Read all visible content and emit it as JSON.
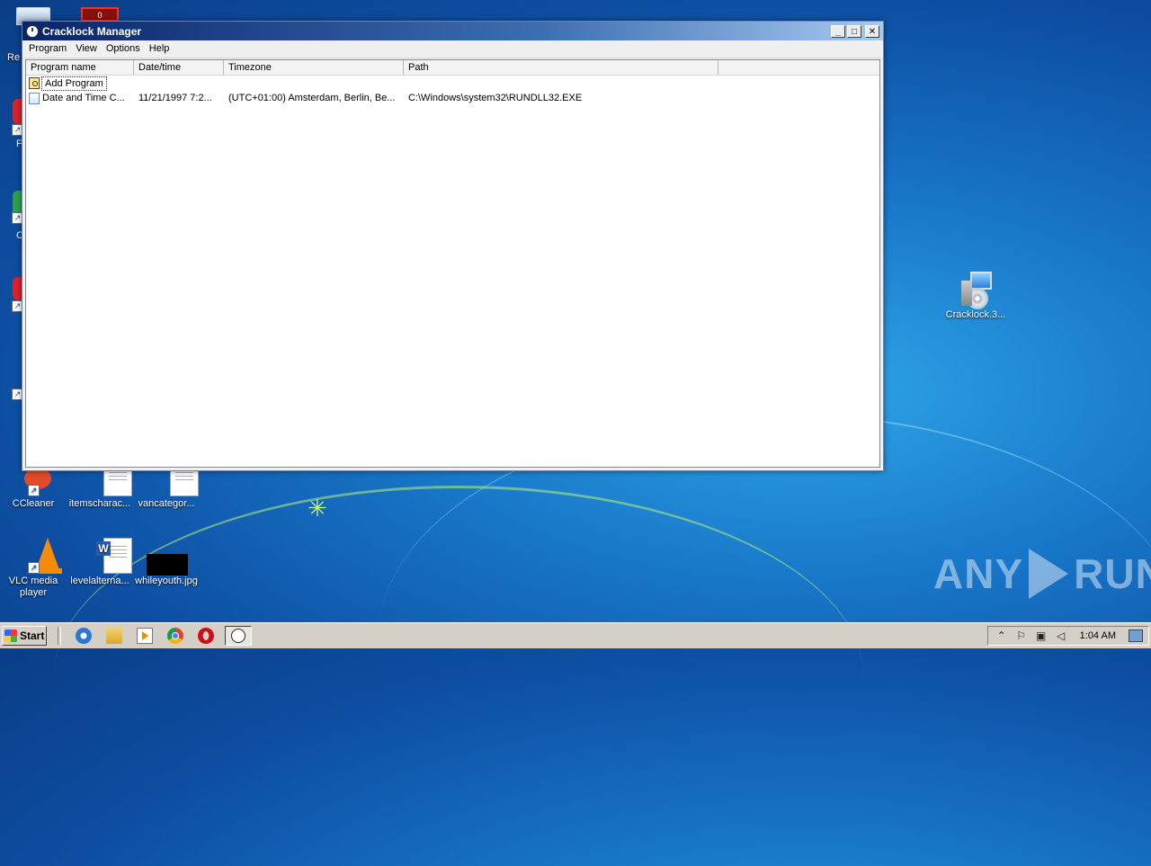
{
  "window": {
    "title": "Cracklock Manager",
    "buttons": {
      "minimize": "_",
      "maximize": "□",
      "close": "✕"
    }
  },
  "menu": [
    "Program",
    "View",
    "Options",
    "Help"
  ],
  "listview": {
    "columns": [
      "Program name",
      "Date/time",
      "Timezone",
      "Path"
    ],
    "rows": [
      {
        "name": "Add Program",
        "datetime": "",
        "timezone": "",
        "path": "",
        "icon": "add-program-icon"
      },
      {
        "name": "Date and Time C...",
        "datetime": "11/21/1997 7:2...",
        "timezone": "(UTC+01:00) Amsterdam, Berlin, Be...",
        "path": "C:\\Windows\\system32\\RUNDLL32.EXE",
        "icon": "date-time-icon"
      }
    ]
  },
  "desktop": {
    "icons": [
      {
        "label": "Cracklock.3...",
        "icon": "installer-icon"
      },
      {
        "label": "CCleaner",
        "icon": "ccleaner-icon"
      },
      {
        "label": "itemscharac...",
        "icon": "document-icon"
      },
      {
        "label": "vancategor...",
        "icon": "document-icon"
      },
      {
        "label": "VLC media player",
        "icon": "vlc-icon"
      },
      {
        "label": "levelalterna...",
        "icon": "word-document-icon"
      },
      {
        "label": "whileyouth.jpg",
        "icon": "image-icon"
      }
    ],
    "partial_labels": {
      "recycle": "Re",
      "second": "F",
      "third": "C"
    },
    "top_file_text": "0"
  },
  "taskbar": {
    "start_label": "Start",
    "clock": "1:04 AM"
  },
  "watermark": {
    "left": "ANY",
    "right": "RUN"
  }
}
